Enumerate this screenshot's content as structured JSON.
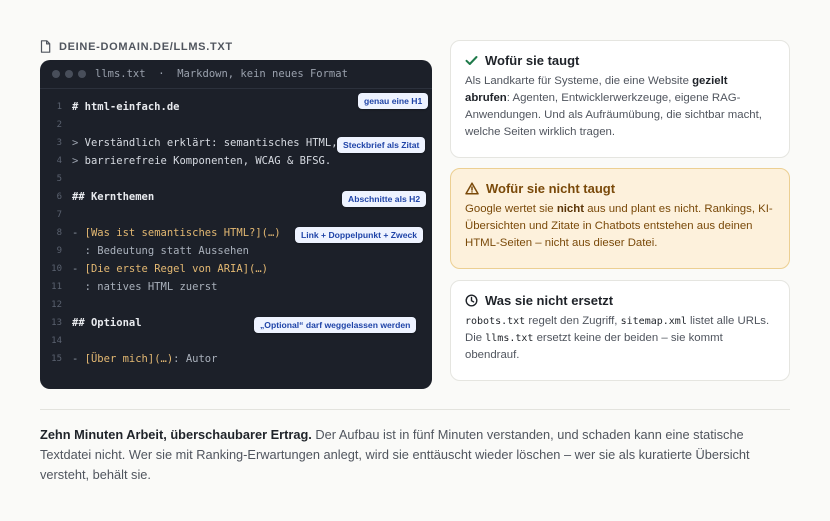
{
  "file": {
    "label": "DEINE-DOMAIN.DE/LLMS.TXT",
    "icon": "file-icon"
  },
  "editor": {
    "filename": "llms.txt",
    "separator": "·",
    "subtitle": "Markdown, kein neues Format",
    "lines": [
      {
        "n": "1",
        "parts": [
          [
            "h",
            "# html-einfach.de"
          ]
        ]
      },
      {
        "n": "2",
        "parts": []
      },
      {
        "n": "3",
        "parts": [
          [
            "q",
            "> "
          ],
          [
            "t",
            "Verständlich erklärt: semantisches HTML,"
          ]
        ]
      },
      {
        "n": "4",
        "parts": [
          [
            "q",
            "> "
          ],
          [
            "t",
            "barrierefreie Komponenten, WCAG & BFSG."
          ]
        ]
      },
      {
        "n": "5",
        "parts": []
      },
      {
        "n": "6",
        "parts": [
          [
            "h",
            "## Kernthemen"
          ]
        ]
      },
      {
        "n": "7",
        "parts": []
      },
      {
        "n": "8",
        "parts": [
          [
            "m",
            "- "
          ],
          [
            "l",
            "[Was ist semantisches HTML?](…)"
          ]
        ]
      },
      {
        "n": "9",
        "parts": [
          [
            "d",
            "  : Bedeutung statt Aussehen"
          ]
        ]
      },
      {
        "n": "10",
        "parts": [
          [
            "m",
            "- "
          ],
          [
            "l",
            "[Die erste Regel von ARIA](…)"
          ]
        ]
      },
      {
        "n": "11",
        "parts": [
          [
            "d",
            "  : natives HTML zuerst"
          ]
        ]
      },
      {
        "n": "12",
        "parts": []
      },
      {
        "n": "13",
        "parts": [
          [
            "h",
            "## Optional"
          ]
        ]
      },
      {
        "n": "14",
        "parts": []
      },
      {
        "n": "15",
        "parts": [
          [
            "m",
            "- "
          ],
          [
            "l",
            "[Über mich](…)"
          ],
          [
            "d",
            ": Autor"
          ]
        ]
      }
    ],
    "annotations": [
      {
        "label": "genau eine H1"
      },
      {
        "label": "Steckbrief als Zitat"
      },
      {
        "label": "Abschnitte als H2"
      },
      {
        "label": "Link + Doppelpunkt + Zweck"
      },
      {
        "label": "„Optional“ darf weggelassen werden"
      }
    ]
  },
  "cards": {
    "good": {
      "icon": "check-icon",
      "title": "Wofür sie taugt",
      "text_before": "Als Landkarte für Systeme, die eine Website ",
      "text_bold": "gezielt abrufen",
      "text_after": ": Agenten, Entwicklerwerkzeuge, eigene RAG-Anwendungen. Und als Aufräumübung, die sichtbar macht, welche Seiten wirklich tragen."
    },
    "bad": {
      "icon": "warning-icon",
      "title": "Wofür sie nicht taugt",
      "text_before": "Google wertet sie ",
      "text_bold": "nicht",
      "text_after": " aus und plant es nicht. Rankings, KI-Übersichten und Zitate in Chatbots entstehen aus deinen HTML-Seiten – nicht aus dieser Datei."
    },
    "noreplace": {
      "icon": "clock-icon",
      "title": "Was sie nicht ersetzt",
      "code1": "robots.txt",
      "text1": " regelt den Zugriff, ",
      "code2": "sitemap.xml",
      "text2": " listet alle URLs. Die ",
      "code3": "llms.txt",
      "text3": " ersetzt keine der beiden – sie kommt obendrauf."
    }
  },
  "summary": {
    "bold": "Zehn Minuten Arbeit, überschaubarer Ertrag.",
    "text": " Der Aufbau ist in fünf Minuten verstanden, und schaden kann eine statische Textdatei nicht. Wer sie mit Ranking-Erwartungen anlegt, wird sie enttäuscht wieder löschen – wer sie als kuratierte Übersicht versteht, behält sie."
  },
  "colors": {
    "editor_bg": "#1c2029",
    "tag_bg": "#eef3ff",
    "tag_text": "#1f44a8",
    "warn_bg": "#fdf1dc",
    "check": "#1f7a4a"
  }
}
